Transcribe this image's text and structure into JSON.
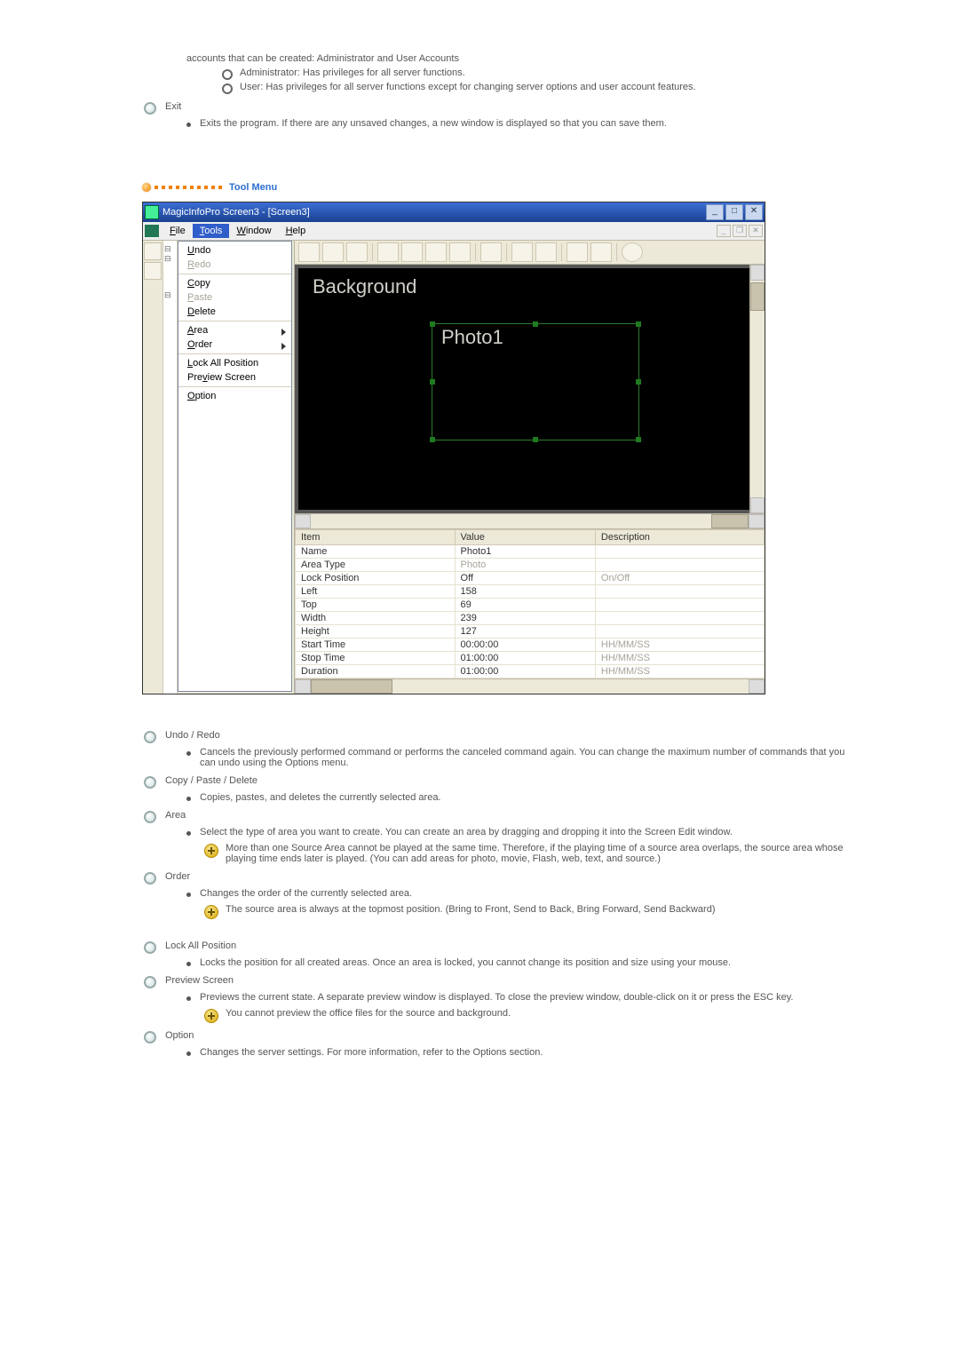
{
  "intro": {
    "line": "accounts that can be created: Administrator and User Accounts",
    "sub": [
      "Administrator: Has privileges for all server functions.",
      "User: Has privileges for all server functions except for changing server options and user account features."
    ]
  },
  "exit": {
    "title": "Exit",
    "desc": "Exits the program. If there are any unsaved changes, a new window is displayed so that you can save them."
  },
  "heading": "Tool Menu",
  "toolList": [
    {
      "title": "Undo / Redo",
      "bullets": [
        "Cancels the previously performed command or performs the canceled command again. You can change the maximum number of commands that you can undo using the Options menu."
      ]
    },
    {
      "title": "Copy / Paste / Delete",
      "bullets": [
        "Copies, pastes, and deletes the currently selected area."
      ]
    },
    {
      "title": "Area",
      "bullets": [
        "Select the type of area you want to create. You can create an area by dragging and dropping it into the Screen Edit window."
      ],
      "plus": [
        "More than one Source Area cannot be played at the same time. Therefore, if the playing time of a source area overlaps, the source area whose playing time ends later is played. (You can add areas for photo, movie, Flash, web, text, and source.)"
      ]
    },
    {
      "title": "Order",
      "bullets": [
        "Changes the order of the currently selected area."
      ],
      "plus": [
        "The source area is always at the topmost position. (Bring to Front, Send to Back, Bring Forward, Send Backward)"
      ]
    },
    {
      "title": "Lock All Position",
      "bullets": [
        "Locks the position for all created areas. Once an area is locked, you cannot change its position and size using your mouse."
      ]
    },
    {
      "title": "Preview Screen",
      "bullets": [
        "Previews the current state. A separate preview window is displayed. To close the preview window, double-click on it or press the ESC key."
      ],
      "plus": [
        "You cannot preview the office files for the source and background."
      ]
    },
    {
      "title": "Option",
      "bullets": [
        "Changes the server settings. For more information, refer to the Options section."
      ]
    }
  ],
  "shot": {
    "title": "MagicInfoPro Screen3 - [Screen3]",
    "menubar": [
      "File",
      "Tools",
      "Window",
      "Help"
    ],
    "popup": {
      "grp1": [
        {
          "label": "Undo",
          "u": "U",
          "dis": false
        },
        {
          "label": "Redo",
          "u": "R",
          "dis": true
        }
      ],
      "grp2": [
        {
          "label": "Copy",
          "u": "C",
          "dis": false
        },
        {
          "label": "Paste",
          "u": "P",
          "dis": true
        },
        {
          "label": "Delete",
          "u": "D",
          "dis": false
        }
      ],
      "grp3": [
        {
          "label": "Area",
          "u": "A",
          "sub": true
        },
        {
          "label": "Order",
          "u": "O",
          "sub": true
        }
      ],
      "grp4": [
        {
          "label": "Lock All Position",
          "u": "L"
        },
        {
          "label": "Preview Screen",
          "u": "v"
        }
      ],
      "grp5": [
        {
          "label": "Option",
          "u": "O"
        }
      ]
    },
    "bgLabel": "Background",
    "photoLabel": "Photo1",
    "table": {
      "headers": [
        "Item",
        "Value",
        "Description"
      ],
      "rows": [
        [
          "Name",
          "Photo1",
          ""
        ],
        [
          "Area Type",
          "Photo",
          ""
        ],
        [
          "Lock Position",
          "Off",
          "On/Off"
        ],
        [
          "Left",
          "158",
          ""
        ],
        [
          "Top",
          "69",
          ""
        ],
        [
          "Width",
          "239",
          ""
        ],
        [
          "Height",
          "127",
          ""
        ],
        [
          "Start Time",
          "00:00:00",
          "HH/MM/SS"
        ],
        [
          "Stop Time",
          "01:00:00",
          "HH/MM/SS"
        ],
        [
          "Duration",
          "01:00:00",
          "HH/MM/SS"
        ]
      ]
    }
  }
}
